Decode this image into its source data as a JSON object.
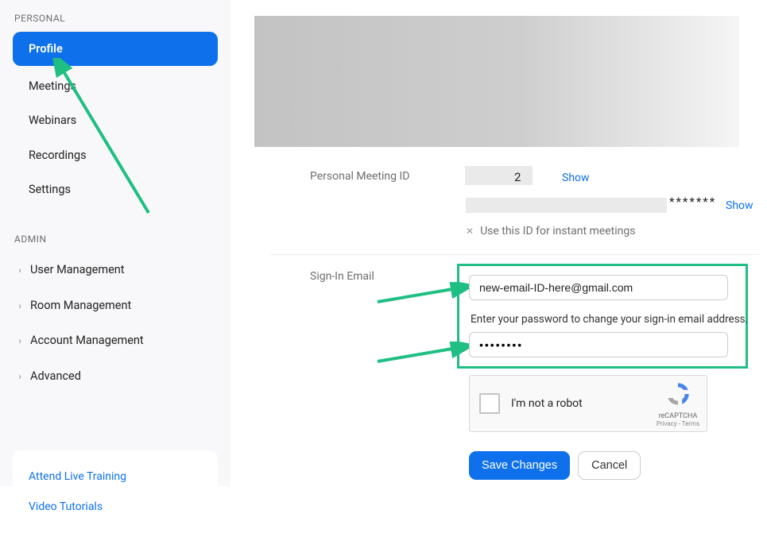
{
  "sidebar": {
    "personal_header": "PERSONAL",
    "items": [
      "Profile",
      "Meetings",
      "Webinars",
      "Recordings",
      "Settings"
    ],
    "admin_header": "ADMIN",
    "admin_items": [
      "User Management",
      "Room Management",
      "Account Management",
      "Advanced"
    ],
    "links": [
      "Attend Live Training",
      "Video Tutorials"
    ]
  },
  "profile": {
    "pmi_label": "Personal Meeting ID",
    "pmi_digit": "2",
    "show": "Show",
    "masked": "*******",
    "instant_label": "Use this ID for instant meetings",
    "signin_label": "Sign-In Email",
    "email_value": "new-email-ID-here@gmail.com",
    "password_note": "Enter your password to change your sign-in email address.",
    "password_value": "••••••••",
    "recaptcha_text": "I'm not a robot",
    "recaptcha_label": "reCAPTCHA",
    "recaptcha_terms": "Privacy - Terms",
    "save_button": "Save Changes",
    "cancel_button": "Cancel"
  }
}
